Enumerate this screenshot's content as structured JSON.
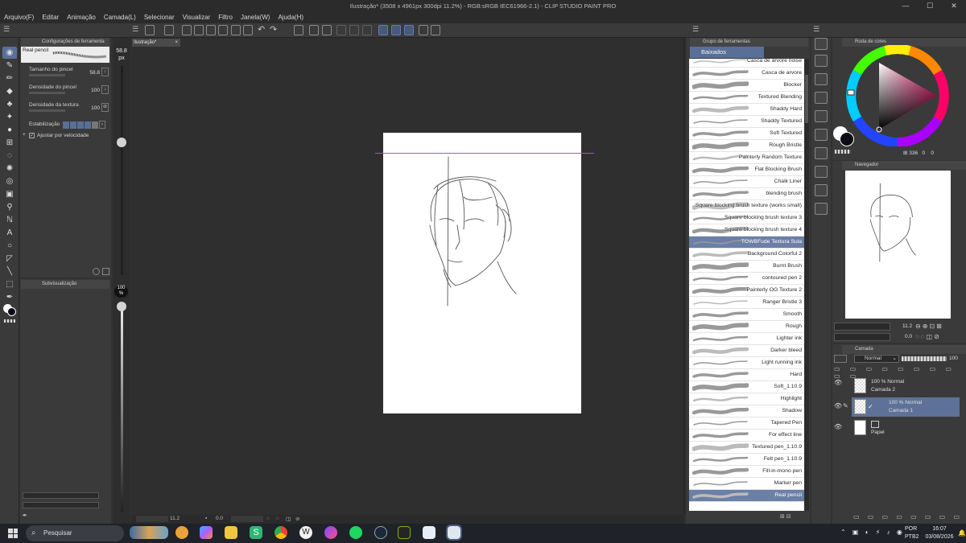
{
  "window": {
    "title": "Ilustração* (3508 x 4961px 300dpi 11.2%) - RGB:sRGB IEC61966-2.1) - CLIP STUDIO PAINT PRO",
    "minimize": "—",
    "maximize": "☐",
    "close": "✕"
  },
  "menu": [
    "Arquivo(F)",
    "Editar",
    "Animação",
    "Camada(L)",
    "Selecionar",
    "Visualizar",
    "Filtro",
    "Janela(W)",
    "Ajuda(H)"
  ],
  "tool_settings": {
    "tab_label": "Configurações de ferramenta",
    "brush_name": "Real pencil",
    "props": [
      {
        "label": "Tamanho do pincel",
        "value": "58.8"
      },
      {
        "label": "Densidade do pincel",
        "value": "100"
      },
      {
        "label": "Densidade da textura",
        "value": "100"
      }
    ],
    "stabilization_label": "Estabilização",
    "velocity_label": "Ajustar por velocidade"
  },
  "subview": {
    "tab_label": "Subvisualização"
  },
  "size_slider": {
    "value": "58.8",
    "unit": "px",
    "opacity": "100",
    "opacity_unit": "%"
  },
  "document": {
    "tab_label": "Ilustração*"
  },
  "statusbar": {
    "zoom": "11.2",
    "angle": "0.0"
  },
  "brush_group": {
    "tab_label": "Grupo de ferramentas",
    "group_name": "Baixados",
    "brushes": [
      "Casca de arvore noise",
      "Casca de arvore",
      "Blocker",
      "Textured Blending",
      "Shaddy Hard",
      "Shaddy Textured",
      "Soft Textured",
      "Rough Bristle",
      "Painterly Random Texture",
      "Flat Blocking Brush",
      "Chalk Liner",
      "blending brush",
      "Square blocking brush texture (works small)",
      "Square blocking brush texture 3",
      "Square blocking brush texture 4",
      "TOWBFude Textura Sula",
      "Background Colorful 2",
      "Burnt Brush",
      "contoured pen 2",
      "Painterly OG  Texture 2",
      "Ranger Bristle 3",
      "Smooth",
      "Rough",
      "Lighter ink",
      "Darker bleed",
      "Light running ink",
      "Hard",
      "Soft_1.10.9",
      "Highlight",
      "Shadow",
      "Tapered Pen",
      "For effect line",
      "Textured pen_1.10.9",
      "Felt pen_1.10.9",
      "Fill-in-mono pen",
      "Marker pen",
      "Real pencil"
    ],
    "selected_index": 15,
    "active_index": 36
  },
  "color_wheel": {
    "tab_label": "Roda de cores",
    "hue_value": "336",
    "saturation_value": "0",
    "brightness_value": "0",
    "main_color": "#0c0c16",
    "sub_color": "#ffffff"
  },
  "navigator": {
    "tab_label": "Navegador",
    "zoom": "11.2",
    "angle": "0.0"
  },
  "layers": {
    "tab_label": "Camada",
    "blend_mode": "Normal",
    "opacity": "100",
    "items": [
      {
        "line1": "100 % Normal",
        "line2": "Camada 2"
      },
      {
        "line1": "100 % Normal",
        "line2": "Camada 1"
      },
      {
        "line1": "",
        "line2": "Papel"
      }
    ],
    "selected_index": 1
  },
  "taskbar": {
    "search_placeholder": "Pesquisar",
    "lang_line1": "POR",
    "lang_line2": "PTB2",
    "time": "16:07",
    "date": "03/08/2026",
    "apps": [
      "widgets-icon",
      "burger-icon",
      "copilot-icon",
      "files-icon",
      "s-app-icon",
      "chrome-icon",
      "w-app-icon",
      "messenger-icon",
      "spotify-icon",
      "steam-icon",
      "nvidia-icon",
      "clip-studio-icon",
      "clip-studio-paint-icon"
    ]
  }
}
